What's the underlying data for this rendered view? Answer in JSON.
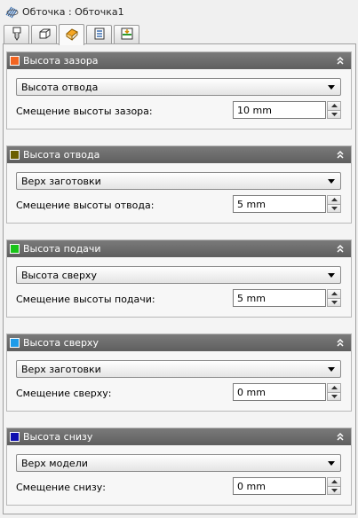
{
  "window": {
    "title": "Обточка : Обточка1"
  },
  "tabs": [
    {
      "icon": "tool-icon"
    },
    {
      "icon": "stock-icon"
    },
    {
      "icon": "heights-icon"
    },
    {
      "icon": "passes-icon"
    },
    {
      "icon": "linking-icon"
    }
  ],
  "groups": [
    {
      "title": "Высота зазора",
      "color": "#f26522",
      "reference": "Высота отвода",
      "offset_label": "Смещение высоты зазора:",
      "offset_value": "10 mm"
    },
    {
      "title": "Высота отвода",
      "color": "#6b5e00",
      "reference": "Верх заготовки",
      "offset_label": "Смещение высоты отвода:",
      "offset_value": "5 mm"
    },
    {
      "title": "Высота подачи",
      "color": "#19c419",
      "reference": "Высота сверху",
      "offset_label": "Смещение высоты подачи:",
      "offset_value": "5 mm"
    },
    {
      "title": "Высота сверху",
      "color": "#1e9be8",
      "reference": "Верх заготовки",
      "offset_label": "Смещение сверху:",
      "offset_value": "0 mm"
    },
    {
      "title": "Высота снизу",
      "color": "#1010b0",
      "reference": "Верх модели",
      "offset_label": "Смещение снизу:",
      "offset_value": "0 mm"
    }
  ]
}
